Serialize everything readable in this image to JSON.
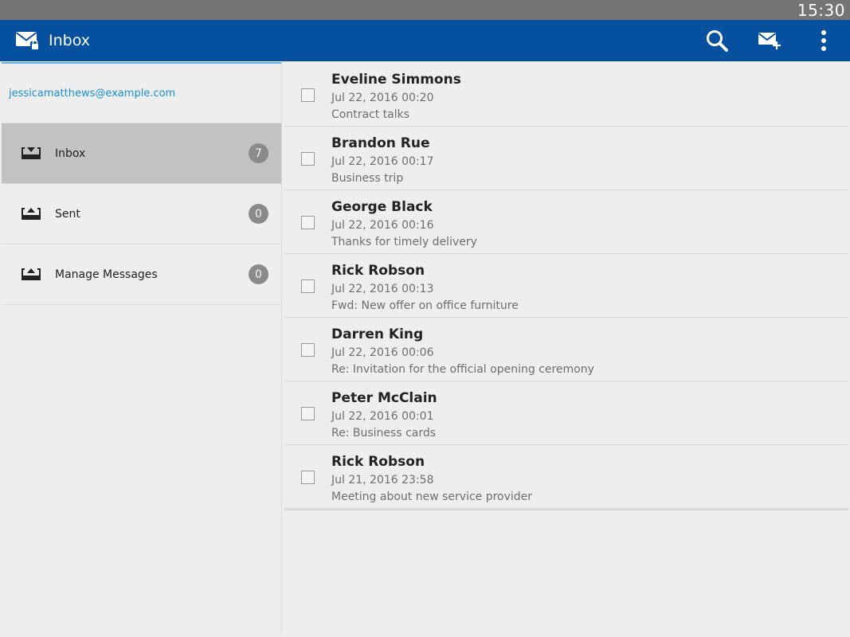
{
  "status_bar": {
    "time": "15:30"
  },
  "app_bar": {
    "title": "Inbox",
    "icons": {
      "app": "mail-lock-icon",
      "search": "search-icon",
      "compose": "compose-mail-icon",
      "overflow": "overflow-menu-icon"
    }
  },
  "colors": {
    "app_bar": "#0650a0",
    "account_text": "#1a8fd4",
    "active_item": "#c2c2c2",
    "badge": "#8a8a8a",
    "accent_line": "#64b5ea"
  },
  "sidebar": {
    "account": "jessicamatthews@example.com",
    "items": [
      {
        "label": "Inbox",
        "count": "7",
        "icon": "inbox-tray-icon",
        "active": true
      },
      {
        "label": "Sent",
        "count": "0",
        "icon": "outbox-tray-icon",
        "active": false
      },
      {
        "label": "Manage Messages",
        "count": "0",
        "icon": "outbox-tray-icon",
        "active": false
      }
    ]
  },
  "messages": [
    {
      "sender": "Eveline Simmons",
      "date": "Jul 22, 2016 00:20",
      "subject": "Contract talks"
    },
    {
      "sender": "Brandon Rue",
      "date": "Jul 22, 2016 00:17",
      "subject": "Business trip"
    },
    {
      "sender": "George Black",
      "date": "Jul 22, 2016 00:16",
      "subject": "Thanks for timely delivery"
    },
    {
      "sender": "Rick Robson",
      "date": "Jul 22, 2016 00:13",
      "subject": "Fwd: New offer on office furniture"
    },
    {
      "sender": "Darren King",
      "date": "Jul 22, 2016 00:06",
      "subject": "Re: Invitation for the official opening ceremony"
    },
    {
      "sender": "Peter McClain",
      "date": "Jul 22, 2016 00:01",
      "subject": "Re: Business cards"
    },
    {
      "sender": "Rick Robson",
      "date": "Jul 21, 2016 23:58",
      "subject": "Meeting about new service provider"
    }
  ]
}
